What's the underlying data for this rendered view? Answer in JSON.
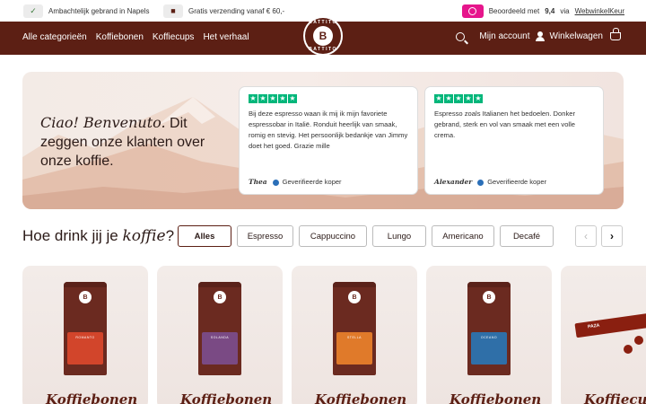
{
  "topbar": {
    "usp1": "Ambachtelijk gebrand in Napels",
    "usp2": "Gratis verzending vanaf € 60,-",
    "rating_prefix": "Beoordeeld met",
    "rating_score": "9,4",
    "rating_via": "via",
    "rating_link": "WebwinkelKeur"
  },
  "nav": {
    "links": [
      "Alle categorieën",
      "Koffiebonen",
      "Koffiecups",
      "Het verhaal"
    ],
    "account": "Mijn account",
    "cart": "Winkelwagen",
    "logo_letter": "B",
    "logo_text": "BATTITO"
  },
  "hero": {
    "title_em": "Ciao! Benvenuto.",
    "title_rest": " Dit zeggen onze klanten over onze koffie.",
    "reviews": [
      {
        "text": "Bij deze espresso waan ik mij ik mijn favoriete espressobar in Italië. Ronduit heerlijk van smaak, romig en stevig. Het persoonlijk bedankje van Jimmy doet het goed. Grazie mille",
        "author": "Thea",
        "badge": "Geverifieerde koper"
      },
      {
        "text": "Espresso zoals Italianen het bedoelen. Donker gebrand, sterk en vol van smaak met een volle crema.",
        "author": "Alexander",
        "badge": "Geverifieerde koper"
      }
    ]
  },
  "section": {
    "title_start": "Hoe drink jij je ",
    "title_em": "koffie",
    "title_end": "?",
    "filters": [
      "Alles",
      "Espresso",
      "Cappuccino",
      "Lungo",
      "Americano",
      "Decafé"
    ]
  },
  "products": [
    {
      "title": "Koffiebonen",
      "label": "ROMANTO",
      "color": "#d2452b"
    },
    {
      "title": "Koffiebonen",
      "label": "SOLANDA",
      "color": "#7a4a84"
    },
    {
      "title": "Koffiebonen",
      "label": "STELLA",
      "color": "#e07a2a"
    },
    {
      "title": "Koffiebonen",
      "label": "OCEANO",
      "color": "#2f6fa8"
    },
    {
      "title": "Koffiecups",
      "label": "PAZA",
      "color": "#8a1f10"
    }
  ]
}
